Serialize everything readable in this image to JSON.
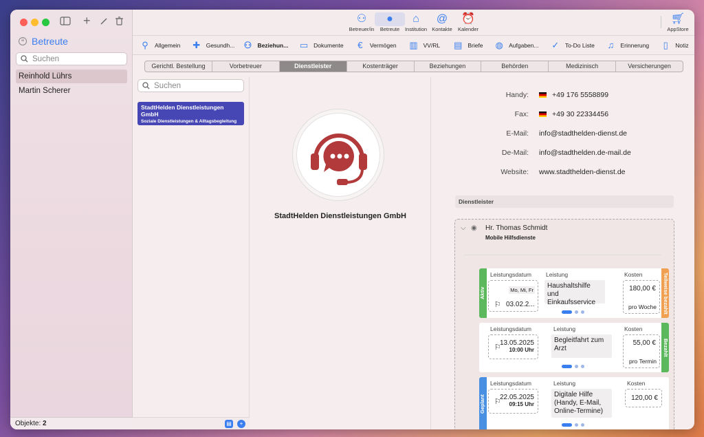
{
  "sidebar": {
    "title": "Betreute",
    "search_placeholder": "Suchen",
    "items": [
      {
        "label": "Reinhold Lührs",
        "selected": true
      },
      {
        "label": "Martin Scherer",
        "selected": false
      }
    ],
    "footer_label": "Objekte:",
    "footer_count": "2"
  },
  "toolbar": {
    "buttons": [
      {
        "label": "Betreuer/in",
        "icon": "people-icon"
      },
      {
        "label": "Betreute",
        "icon": "person-icon"
      },
      {
        "label": "Institution",
        "icon": "institution-icon"
      },
      {
        "label": "Kontakte",
        "icon": "contacts-icon"
      },
      {
        "label": "Kalender",
        "icon": "alarm-clock-icon"
      }
    ],
    "appstore_label": "AppStore"
  },
  "nav": {
    "items": [
      {
        "label": "Allgemein"
      },
      {
        "label": "Gesundh..."
      },
      {
        "label": "Beziehun..."
      },
      {
        "label": "Dokumente"
      },
      {
        "label": "Vermögen"
      },
      {
        "label": "VV/RL"
      },
      {
        "label": "Briefe"
      },
      {
        "label": "Aufgaben..."
      },
      {
        "label": "To-Do Liste"
      },
      {
        "label": "Erinnerung"
      },
      {
        "label": "Notiz"
      }
    ]
  },
  "segments": [
    "Gerichtl. Bestellung",
    "Vorbetreuer",
    "Dienstleister",
    "Kostenträger",
    "Beziehungen",
    "Behörden",
    "Medizinisch",
    "Versicherungen"
  ],
  "selected_segment": "Dienstleister",
  "list": {
    "search_placeholder": "Suchen",
    "card_title": "StadtHelden Dienstleistungen GmbH",
    "card_subtitle": "Soziale Dienstleistungen & Alltagsbegleitung"
  },
  "detail": {
    "company_name": "StadtHelden Dienstleistungen GmbH",
    "contacts": [
      {
        "label": "Handy:",
        "value": "+49 176 5558899",
        "flag": true
      },
      {
        "label": "Fax:",
        "value": "+49 30 22334456",
        "flag": true
      },
      {
        "label": "E-Mail:",
        "value": "info@stadthelden-dienst.de",
        "flag": false
      },
      {
        "label": "De-Mail:",
        "value": "info@stadthelden.de-mail.de",
        "flag": false
      },
      {
        "label": "Website:",
        "value": "www.stadthelden-dienst.de",
        "flag": false
      }
    ],
    "section_title": "Dienstleister",
    "person": "Hr. Thomas Schmidt",
    "org": "Mobile Hilfsdienste",
    "headers": {
      "date": "Leistungsdatum",
      "service": "Leistung",
      "cost": "Kosten"
    },
    "services": [
      {
        "left_tag": "Aktiv",
        "left_color": "#5cb85c",
        "right_tag": "Teilweise bezahlt",
        "right_color": "#f0a050",
        "days": "Mo, Mi, Fr",
        "date": "03.02.2...",
        "time": "",
        "service": "Haushaltshilfe und Einkaufsservice",
        "cost": "180,00 €",
        "per": "pro Woche"
      },
      {
        "left_tag": "",
        "left_color": "",
        "right_tag": "Bezahlt",
        "right_color": "#5cb85c",
        "days": "",
        "date": "13.05.2025",
        "time": "10:00 Uhr",
        "service": "Begleitfahrt zum Arzt",
        "cost": "55,00 €",
        "per": "pro Termin"
      },
      {
        "left_tag": "Geplant",
        "left_color": "#4a90e2",
        "right_tag": "",
        "right_color": "",
        "days": "",
        "date": "22.05.2025",
        "time": "09:15 Uhr",
        "service": "Digitale Hilfe (Handy, E-Mail, Online-Termine)",
        "cost": "120,00 €",
        "per": ""
      }
    ]
  }
}
